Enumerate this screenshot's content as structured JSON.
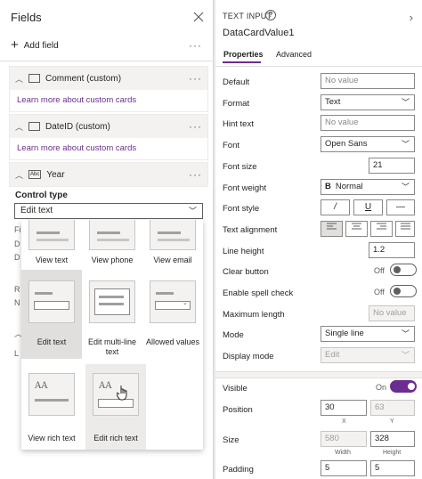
{
  "fields_panel": {
    "title": "Fields",
    "add_field_label": "Add field",
    "more": "···",
    "sections": [
      {
        "name": "Comment (custom)",
        "link": "Learn more about custom cards"
      },
      {
        "name": "DateID (custom)",
        "link": "Learn more about custom cards"
      },
      {
        "name": "Year"
      }
    ],
    "control_type_label": "Control type",
    "control_type_value": "Edit text",
    "behind_letters": [
      "Fi",
      "D",
      "D",
      "R",
      "N",
      "L"
    ]
  },
  "gallery": {
    "items": [
      {
        "label": "View text"
      },
      {
        "label": "View phone"
      },
      {
        "label": "View email"
      },
      {
        "label": "Edit text"
      },
      {
        "label": "Edit multi-line text"
      },
      {
        "label": "Allowed values"
      },
      {
        "label": "View rich text"
      },
      {
        "label": "Edit rich text"
      }
    ],
    "rich_glyph": "AA"
  },
  "properties": {
    "type_label": "TEXT INPUT",
    "card_name": "DataCardValue1",
    "tabs": [
      "Properties",
      "Advanced"
    ],
    "default_label": "Default",
    "default_placeholder": "No value",
    "format_label": "Format",
    "format_value": "Text",
    "hint_label": "Hint text",
    "hint_placeholder": "No value",
    "font_label": "Font",
    "font_value": "Open Sans",
    "font_size_label": "Font size",
    "font_size_value": "21",
    "font_weight_label": "Font weight",
    "font_weight_glyph": "B",
    "font_weight_value": "Normal",
    "font_style_label": "Font style",
    "font_style_buttons": [
      "/",
      "U",
      "—"
    ],
    "text_align_label": "Text alignment",
    "line_height_label": "Line height",
    "line_height_value": "1.2",
    "clear_button_label": "Clear button",
    "clear_button_state": "Off",
    "spell_check_label": "Enable spell check",
    "spell_check_state": "Off",
    "max_length_label": "Maximum length",
    "max_length_placeholder": "No value",
    "mode_label": "Mode",
    "mode_value": "Single line",
    "display_mode_label": "Display mode",
    "display_mode_value": "Edit",
    "visible_label": "Visible",
    "visible_state": "On",
    "position_label": "Position",
    "position_x": "30",
    "position_y": "63",
    "x_label": "X",
    "y_label": "Y",
    "size_label": "Size",
    "size_width": "580",
    "size_height": "328",
    "width_label": "Width",
    "height_label": "Height",
    "padding_label": "Padding",
    "padding_left": "5",
    "padding_right": "5"
  },
  "colors": {
    "accent": "#6b2d8f",
    "panel": "#ffffff",
    "background": "#e8e8e8"
  }
}
